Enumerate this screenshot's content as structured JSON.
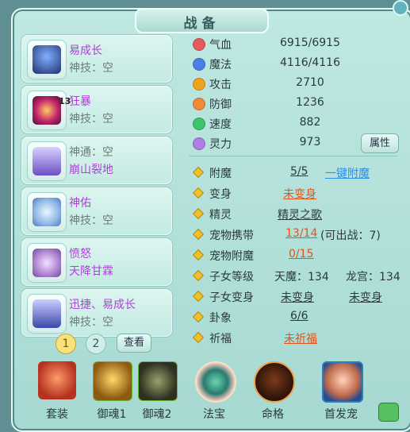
{
  "panel": {
    "title": "战备"
  },
  "slots": [
    {
      "line1": "易成长",
      "line2": "神技：空",
      "line1_color": "purple",
      "line2_color": "gray"
    },
    {
      "line1": "狂暴",
      "line2": "神技：空",
      "line1_color": "purple",
      "line2_color": "gray",
      "badge": "13"
    },
    {
      "line1": "神通：空",
      "line2": "崩山裂地",
      "line1_color": "gray",
      "line2_color": "purple"
    },
    {
      "line1": "神佑",
      "line2": "神技：空",
      "line1_color": "purple",
      "line2_color": "gray"
    },
    {
      "line1": "愤怒",
      "line2": "天降甘霖",
      "line1_color": "purple",
      "line2_color": "purple"
    },
    {
      "line1": "迅捷、易成长",
      "line2": "神技：空",
      "line1_color": "purple",
      "line2_color": "gray"
    }
  ],
  "pagination": {
    "page1": "1",
    "page2": "2",
    "view_button": "查看"
  },
  "stats": [
    {
      "label": "气血",
      "value": "6915/6915",
      "icon": "heart-icon",
      "color": "#e65a5a"
    },
    {
      "label": "魔法",
      "value": "4116/4116",
      "icon": "mana-icon",
      "color": "#4b7ee8"
    },
    {
      "label": "攻击",
      "value": "2710",
      "icon": "attack-icon",
      "color": "#f2a11c"
    },
    {
      "label": "防御",
      "value": "1236",
      "icon": "defense-icon",
      "color": "#f08a3a"
    },
    {
      "label": "速度",
      "value": "882",
      "icon": "speed-icon",
      "color": "#3cc46a"
    },
    {
      "label": "灵力",
      "value": "973",
      "icon": "spirit-icon",
      "color": "#b07ce6"
    }
  ],
  "attr_button": "属性",
  "rows": [
    {
      "label": "附魔",
      "v1": "5/5",
      "v1_style": "dark",
      "v2": "一键附魔",
      "v2_style": "blue"
    },
    {
      "label": "变身",
      "v1": "未变身",
      "v1_style": "orange"
    },
    {
      "label": "精灵",
      "v1": "精灵之歌",
      "v1_style": "dark"
    },
    {
      "label": "宠物携带",
      "v1": "13/14",
      "v1_style": "orange",
      "v2": "(可出战：7)",
      "v2_style": "dark"
    },
    {
      "label": "宠物附魔",
      "v1": "0/15",
      "v1_style": "orange"
    },
    {
      "label": "子女等级",
      "v1": "天魔：134",
      "v1_style": "dark",
      "v2": "龙宫：134",
      "v2_style": "dark"
    },
    {
      "label": "子女变身",
      "v1": "未变身",
      "v1_style": "dark",
      "v2": "未变身",
      "v2_style": "dark"
    },
    {
      "label": "卦象",
      "v1": "6/6",
      "v1_style": "dark"
    },
    {
      "label": "祈福",
      "v1": "未祈福",
      "v1_style": "orange"
    }
  ],
  "footer": [
    {
      "label": "套装",
      "icon": "armor-set-icon"
    },
    {
      "label": "御魂1",
      "icon": "lion-soul-icon"
    },
    {
      "label": "御魂2",
      "icon": "beast-soul-icon"
    },
    {
      "label": "法宝",
      "icon": "treasure-icon"
    },
    {
      "label": "命格",
      "icon": "fate-icon"
    },
    {
      "label": "首发宠",
      "icon": "pet-portrait-icon"
    }
  ]
}
